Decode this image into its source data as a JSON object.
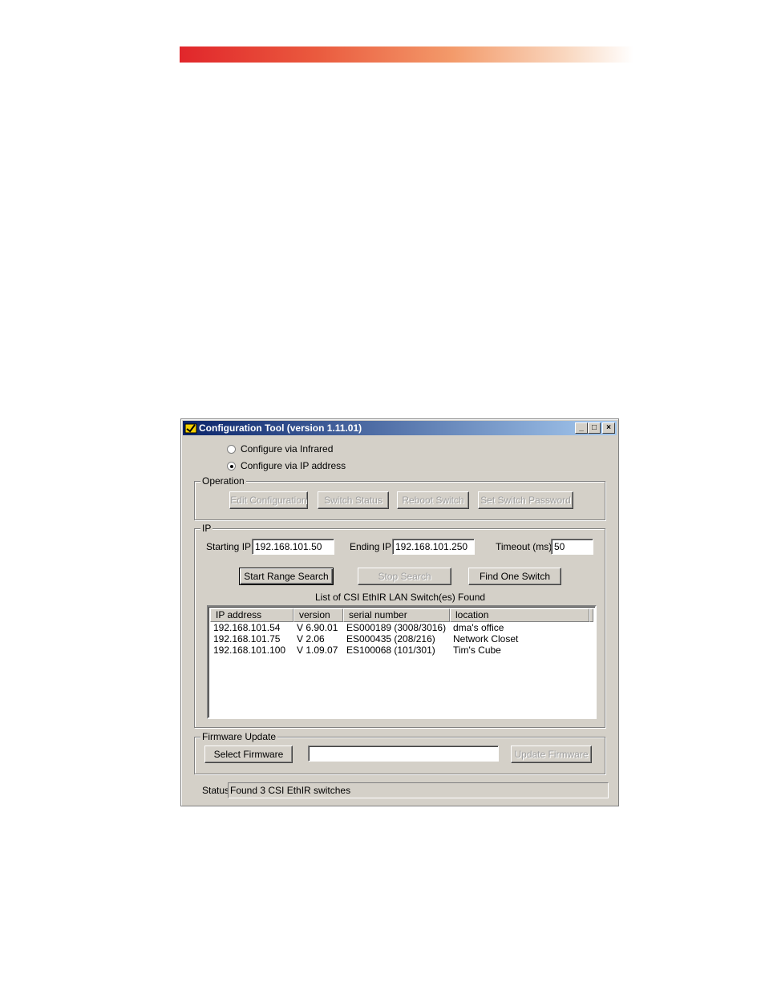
{
  "window": {
    "title": "Configuration Tool (version 1.11.01)",
    "minimize": "_",
    "maximize": "□",
    "close": "×"
  },
  "mode": {
    "infrared_label": "Configure via Infrared",
    "ip_label": "Configure via IP address",
    "selected": "ip"
  },
  "operation": {
    "group_label": "Operation",
    "edit_config": "Edit Configuration",
    "switch_status": "Switch Status",
    "reboot_switch": "Reboot Switch",
    "set_password": "Set Switch Password"
  },
  "ip": {
    "group_label": "IP",
    "starting_ip_label": "Starting IP",
    "starting_ip_value": "192.168.101.50",
    "ending_ip_label": "Ending IP",
    "ending_ip_value": "192.168.101.250",
    "timeout_label": "Timeout (ms)",
    "timeout_value": "50",
    "start_range_search": "Start Range Search",
    "stop_search": "Stop Search",
    "find_one_switch": "Find One Switch",
    "list_caption": "List of CSI EthIR LAN Switch(es) Found",
    "columns": [
      "IP address",
      "version",
      "serial number",
      "location"
    ],
    "rows": [
      [
        "192.168.101.54",
        "V 6.90.01",
        "ES000189 (3008/3016)",
        "dma's office"
      ],
      [
        "192.168.101.75",
        "V 2.06",
        "ES000435 (208/216)",
        "Network Closet"
      ],
      [
        "192.168.101.100",
        "V 1.09.07",
        "ES100068 (101/301)",
        "Tim's Cube"
      ]
    ]
  },
  "firmware": {
    "group_label": "Firmware Update",
    "select_firmware": "Select Firmware",
    "file_value": "",
    "update_firmware": "Update Firmware"
  },
  "status": {
    "label": "Status",
    "value": "Found 3 CSI EthIR switches"
  }
}
